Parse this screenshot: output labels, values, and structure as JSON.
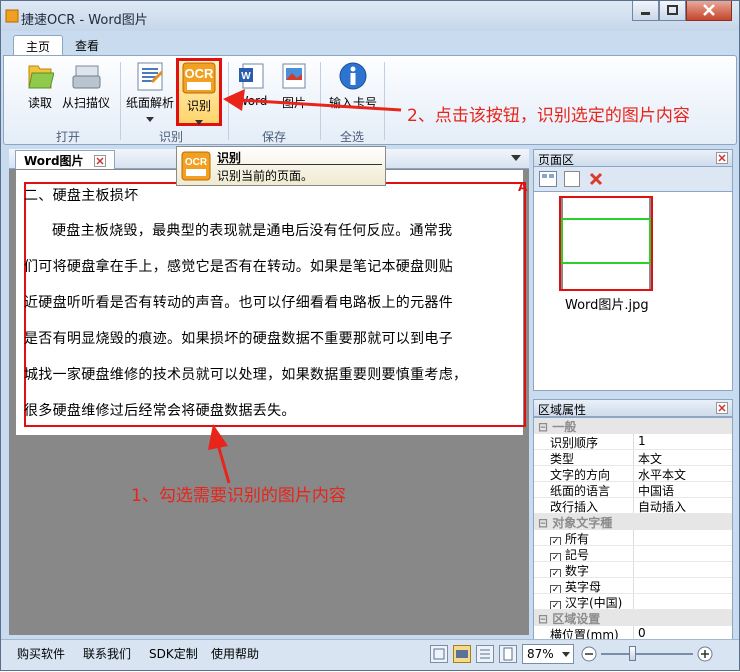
{
  "window": {
    "title": "捷速OCR - Word图片"
  },
  "ribbon_tabs": [
    {
      "label": "主页"
    },
    {
      "label": "查看"
    }
  ],
  "ribbon": {
    "buttons": {
      "read": "读取",
      "scan": "从扫描仪",
      "layout": "纸面解析",
      "recognize": "识别",
      "word": "Word",
      "image": "图片",
      "card": "输入卡号"
    },
    "groups": {
      "open": "打开",
      "recognize": "识别",
      "save": "保存",
      "all": "全选"
    }
  },
  "tooltip": {
    "title": "识别",
    "desc": "识别当前的页面。"
  },
  "document": {
    "tab_label": "Word图片",
    "lines": [
      "二、硬盘主板损坏",
      "硬盘主板烧毁，最典型的表现就是通电后没有任何反应。通常我",
      "们可将硬盘拿在手上，感觉它是否有在转动。如果是笔记本硬盘则贴",
      "近硬盘听听看是否有转动的声音。也可以仔细看看电路板上的元器件",
      "是否有明显烧毁的痕迹。如果损坏的硬盘数据不重要那就可以到电子",
      "城找一家硬盘维修的技术员就可以处理，如果数据重要则要慎重考虑，",
      "很多硬盘维修过后经常会将硬盘数据丢失。"
    ]
  },
  "annotations": {
    "step1": "1、勾选需要识别的图片内容",
    "step2": "2、点击该按钮，识别选定的图片内容"
  },
  "page_panel": {
    "title": "页面区",
    "thumb_label": "Word图片.jpg"
  },
  "props_panel": {
    "title": "区域属性",
    "cat_general": "一般",
    "rows_general": [
      {
        "k": "识别顺序",
        "v": "1"
      },
      {
        "k": "类型",
        "v": "本文"
      },
      {
        "k": "文字的方向",
        "v": "水平本文"
      },
      {
        "k": "纸面的语言",
        "v": "中国语"
      },
      {
        "k": "改行插入",
        "v": "自动插入"
      }
    ],
    "cat_chars": "对象文字種",
    "rows_chars": [
      {
        "k": "所有"
      },
      {
        "k": "記号"
      },
      {
        "k": "数字"
      },
      {
        "k": "英字母"
      },
      {
        "k": "汉字(中国)"
      }
    ],
    "cat_area": "区域设置",
    "row_area": {
      "k": "横位置(mm)",
      "v": "0"
    }
  },
  "status": {
    "links": [
      "购买软件",
      "联系我们",
      "SDK定制",
      "使用帮助"
    ],
    "zoom": "87%"
  },
  "colors": {
    "accent_red": "#e8241b",
    "selection_green": "#2bd12b"
  }
}
